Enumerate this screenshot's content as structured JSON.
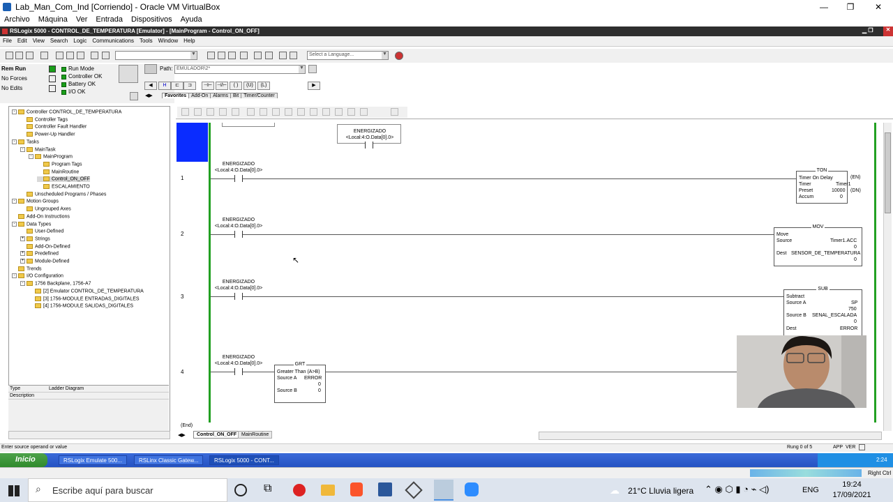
{
  "vbox": {
    "title": "Lab_Man_Com_Ind [Corriendo] - Oracle VM VirtualBox",
    "menu": [
      "Archivo",
      "Máquina",
      "Ver",
      "Entrada",
      "Dispositivos",
      "Ayuda"
    ],
    "status_host_key": "Right Ctrl"
  },
  "rslogix": {
    "title": "RSLogix 5000 - CONTROL_DE_TEMPERATURA [Emulator] - [MainProgram - Control_ON_OFF]",
    "menu": [
      "File",
      "Edit",
      "View",
      "Search",
      "Logic",
      "Communications",
      "Tools",
      "Window",
      "Help"
    ],
    "language_placeholder": "Select a Language...",
    "mode": "Rem Run",
    "forces": "No Forces",
    "edits": "No Edits",
    "status_items": [
      "Run Mode",
      "Controller OK",
      "Battery OK",
      "I/O OK"
    ],
    "path_label": "Path:",
    "path_value": "EMULADOR\\2*",
    "instr_tabs": [
      "Favorites",
      "Add-On",
      "Alarms",
      "Bit",
      "Timer/Counter"
    ]
  },
  "organizer": {
    "items": [
      {
        "label": "Controller CONTROL_DE_TEMPERATURA",
        "level": 0,
        "exp": "-"
      },
      {
        "label": "Controller Tags",
        "level": 1,
        "exp": ""
      },
      {
        "label": "Controller Fault Handler",
        "level": 1,
        "exp": ""
      },
      {
        "label": "Power-Up Handler",
        "level": 1,
        "exp": ""
      },
      {
        "label": "Tasks",
        "level": 0,
        "exp": "-"
      },
      {
        "label": "MainTask",
        "level": 1,
        "exp": "-"
      },
      {
        "label": "MainProgram",
        "level": 2,
        "exp": "-"
      },
      {
        "label": "Program Tags",
        "level": 3,
        "exp": ""
      },
      {
        "label": "MainRoutine",
        "level": 3,
        "exp": ""
      },
      {
        "label": "Control_ON_OFF",
        "level": 3,
        "exp": ""
      },
      {
        "label": "ESCALAMIENTO",
        "level": 3,
        "exp": ""
      },
      {
        "label": "Unscheduled Programs / Phases",
        "level": 1,
        "exp": ""
      },
      {
        "label": "Motion Groups",
        "level": 0,
        "exp": "-"
      },
      {
        "label": "Ungrouped Axes",
        "level": 1,
        "exp": ""
      },
      {
        "label": "Add-On Instructions",
        "level": 0,
        "exp": ""
      },
      {
        "label": "Data Types",
        "level": 0,
        "exp": "-"
      },
      {
        "label": "User-Defined",
        "level": 1,
        "exp": ""
      },
      {
        "label": "Strings",
        "level": 1,
        "exp": "+"
      },
      {
        "label": "Add-On-Defined",
        "level": 1,
        "exp": ""
      },
      {
        "label": "Predefined",
        "level": 1,
        "exp": "+"
      },
      {
        "label": "Module-Defined",
        "level": 1,
        "exp": "+"
      },
      {
        "label": "Trends",
        "level": 0,
        "exp": ""
      },
      {
        "label": "I/O Configuration",
        "level": 0,
        "exp": "-"
      },
      {
        "label": "1756 Backplane, 1756-A7",
        "level": 1,
        "exp": "-"
      },
      {
        "label": "[2] Emulator CONTROL_DE_TEMPERATURA",
        "level": 2,
        "exp": ""
      },
      {
        "label": "[3] 1756-MODULE ENTRADAS_DIGITALES",
        "level": 2,
        "exp": ""
      },
      {
        "label": "[4] 1756-MODULE SALIDAS_DIGITALES",
        "level": 2,
        "exp": ""
      }
    ],
    "props": [
      {
        "k": "Type",
        "v": "Ladder Diagram"
      },
      {
        "k": "Description",
        "v": ""
      }
    ]
  },
  "ladder": {
    "contact_tag": "ENERGIZADO",
    "contact_addr": "<Local:4:O.Data[0].0>",
    "rungs": [
      "1",
      "2",
      "3",
      "4"
    ],
    "end_label": "(End)",
    "ton": {
      "name": "TON",
      "title": "Timer On Delay",
      "rows": [
        {
          "k": "Timer",
          "v": "Timer1"
        },
        {
          "k": "Preset",
          "v": "10000"
        },
        {
          "k": "Accum",
          "v": "0"
        }
      ],
      "en": "(EN)",
      "dn": "(DN)"
    },
    "mov": {
      "name": "MOV",
      "title": "Move",
      "source_k": "Source",
      "source_v": "Timer1.ACC",
      "source_val": "0",
      "dest_k": "Dest",
      "dest_v": "SENSOR_DE_TEMPERATURA",
      "dest_val": "0"
    },
    "sub": {
      "name": "SUB",
      "title": "Subtract",
      "a_k": "Source A",
      "a_v": "SP",
      "a_val": "750",
      "b_k": "Source B",
      "b_v": "SENAL_ESCALADA",
      "b_val": "0",
      "dest_k": "Dest",
      "dest_v": "ERROR"
    },
    "grt": {
      "name": "GRT",
      "title": "Greater Than (A>B)",
      "a_k": "Source A",
      "a_v": "ERROR",
      "a_val": "0",
      "b_k": "Source B",
      "b_val": "0"
    },
    "tabs": [
      "Control_ON_OFF",
      "MainRoutine"
    ]
  },
  "status": {
    "message": "Enter source operand or value",
    "rung": "Rung 0 of 5",
    "app": "APP",
    "ver": "VER"
  },
  "xp": {
    "start": "Inicio",
    "tasks": [
      "RSLogix Emulate 500...",
      "RSLinx Classic Gatew...",
      "RSLogix 5000 - CONT..."
    ],
    "clock": "2:24"
  },
  "win10": {
    "search_placeholder": "Escribe aquí para buscar",
    "weather": "21°C  Lluvia ligera",
    "lang": "ENG",
    "time": "19:24",
    "date": "17/09/2021"
  }
}
